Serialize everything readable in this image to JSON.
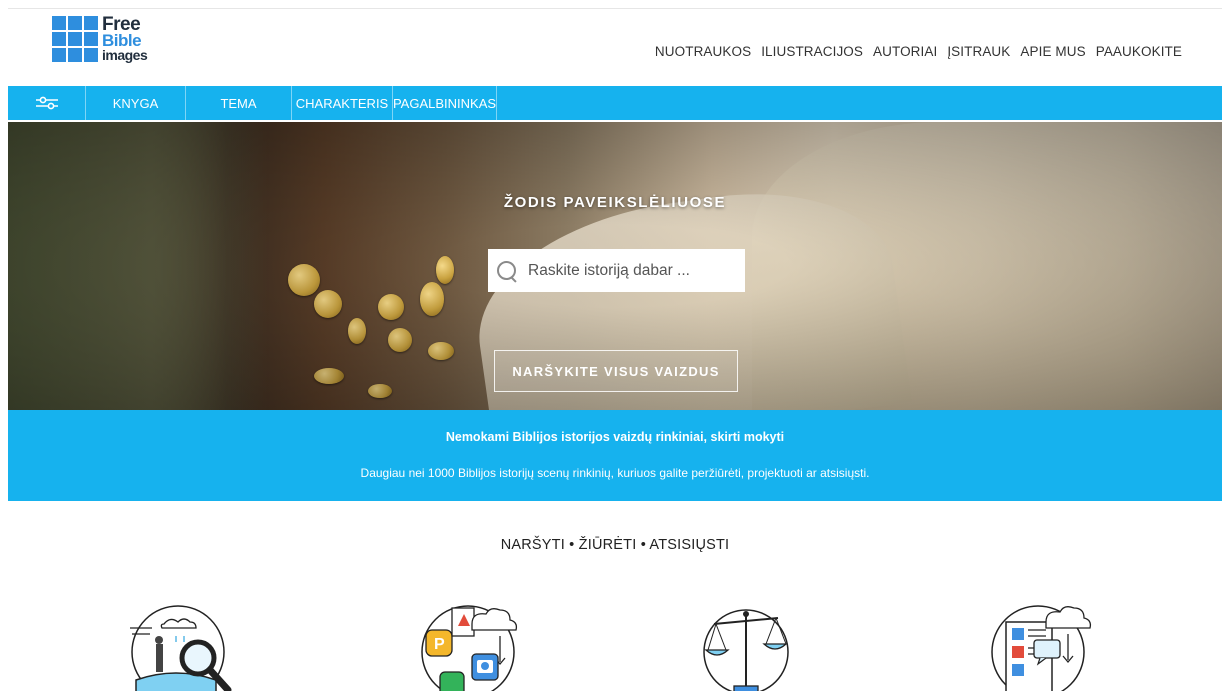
{
  "logo": {
    "line1": "Free",
    "line2": "Bible",
    "line3": "images"
  },
  "topnav": [
    {
      "label": "NUOTRAUKOS"
    },
    {
      "label": "ILIUSTRACIJOS"
    },
    {
      "label": "AUTORIAI"
    },
    {
      "label": "ĮSITRAUK"
    },
    {
      "label": "APIE MUS"
    },
    {
      "label": "PAAUKOKITE"
    }
  ],
  "navbar": {
    "filter_icon": "sliders-icon",
    "items": [
      {
        "label": "KNYGA"
      },
      {
        "label": "TEMA"
      },
      {
        "label": "CHARAKTERIS"
      },
      {
        "label": "PAGALBININKAS"
      }
    ]
  },
  "hero": {
    "title": "ŽODIS PAVEIKSLĖLIUOSE",
    "search_placeholder": "Raskite istoriją dabar ...",
    "browse_label": "NARŠYKITE VISUS VAIZDUS"
  },
  "info": {
    "title": "Nemokami Biblijos istorijos vaizdų rinkiniai, skirti mokyti",
    "subtitle": "Daugiau nei 1000 Biblijos istorijų scenų rinkinių, kuriuos galite peržiūrėti, projektuoti ar atsisiųsti."
  },
  "section": {
    "title": "NARŠYTI • ŽIŪRĖTI • ATSISIŲSTI"
  },
  "features": [
    {
      "icon": "explorer-book-search-icon"
    },
    {
      "icon": "app-formats-cloud-icon"
    },
    {
      "icon": "scales-icon"
    },
    {
      "icon": "document-cloud-download-icon"
    }
  ],
  "colors": {
    "accent": "#16b2ee",
    "logo_blue": "#2e8ede"
  }
}
